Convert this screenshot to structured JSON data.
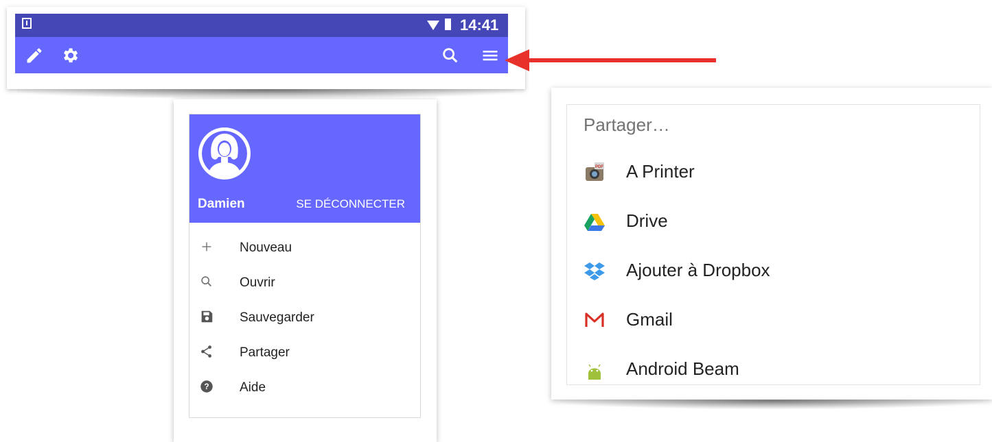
{
  "statusbar": {
    "time": "14:41"
  },
  "appbar": {
    "left_icons": [
      "pencil-icon",
      "gear-icon"
    ],
    "right_icons": [
      "search-icon",
      "hamburger-menu-icon"
    ],
    "colors": {
      "status": "#4547b7",
      "appbar": "#6667ff"
    }
  },
  "annotation": {
    "arrow_color": "#e8312a"
  },
  "drawer": {
    "user_name": "Damien",
    "logout_label": "SE DÉCONNECTER",
    "header_color": "#6667ff",
    "items": [
      {
        "label": "Nouveau",
        "icon": "plus-icon"
      },
      {
        "label": "Ouvrir",
        "icon": "search-icon"
      },
      {
        "label": "Sauvegarder",
        "icon": "save-icon"
      },
      {
        "label": "Partager",
        "icon": "share-icon"
      },
      {
        "label": "Aide",
        "icon": "help-icon"
      }
    ]
  },
  "share_sheet": {
    "title": "Partager…",
    "items": [
      {
        "label": "A Printer",
        "icon": "printer-app-icon"
      },
      {
        "label": "Drive",
        "icon": "drive-icon"
      },
      {
        "label": "Ajouter à Dropbox",
        "icon": "dropbox-icon"
      },
      {
        "label": "Gmail",
        "icon": "gmail-icon"
      },
      {
        "label": "Android Beam",
        "icon": "android-icon"
      }
    ]
  }
}
